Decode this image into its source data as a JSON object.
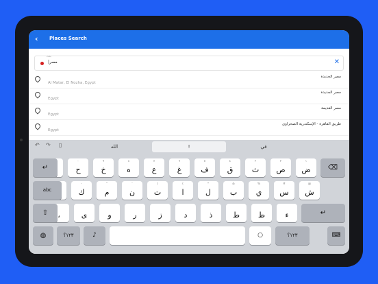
{
  "app": {
    "title": "Places Search",
    "back_icon": "‹"
  },
  "search": {
    "label": "بحث",
    "value": "مصر|",
    "clear_icon": "✕"
  },
  "results": [
    {
      "name": "مصر الجديدة",
      "sub": "Al Matar, El Nozha, Egypt"
    },
    {
      "name": "مصر الجديدة",
      "sub": "Egypt"
    },
    {
      "name": "مصر القديمة",
      "sub": "Egypt"
    },
    {
      "name": "طريق القاهرة - الإسكندرية الصحراوي",
      "sub": "Egypt"
    }
  ],
  "keyboard": {
    "toolbar": {
      "undo": "↶",
      "redo": "↷",
      "paste": "▯"
    },
    "suggestions": [
      "الله",
      "!",
      "في"
    ],
    "row1": [
      {
        "main": "ض",
        "hint": "١"
      },
      {
        "main": "ص",
        "hint": "٢"
      },
      {
        "main": "ث",
        "hint": "٣"
      },
      {
        "main": "ق",
        "hint": "٤"
      },
      {
        "main": "ف",
        "hint": "٥"
      },
      {
        "main": "غ",
        "hint": "٦"
      },
      {
        "main": "ع",
        "hint": "٧"
      },
      {
        "main": "ه",
        "hint": "٨"
      },
      {
        "main": "خ",
        "hint": "٩"
      },
      {
        "main": "ح",
        "hint": "٠"
      },
      {
        "main": "ج",
        "hint": "،"
      }
    ],
    "row2": [
      {
        "main": "ش",
        "hint": "@"
      },
      {
        "main": "س",
        "hint": "#"
      },
      {
        "main": "ي",
        "hint": "%"
      },
      {
        "main": "ب",
        "hint": "&"
      },
      {
        "main": "ل",
        "hint": "*"
      },
      {
        "main": "ا",
        "hint": "("
      },
      {
        "main": "ت",
        "hint": ")"
      },
      {
        "main": "ن",
        "hint": "'"
      },
      {
        "main": "م",
        "hint": "\""
      },
      {
        "main": "ك",
        "hint": "-"
      },
      {
        "main": "ة",
        "hint": ":"
      }
    ],
    "row3": [
      {
        "main": "ء",
        "hint": ""
      },
      {
        "main": "ظ",
        "hint": ""
      },
      {
        "main": "ط",
        "hint": ""
      },
      {
        "main": "ذ",
        "hint": ""
      },
      {
        "main": "د",
        "hint": ""
      },
      {
        "main": "ز",
        "hint": ""
      },
      {
        "main": "ر",
        "hint": ""
      },
      {
        "main": "و",
        "hint": ""
      },
      {
        "main": "ى",
        "hint": ""
      },
      {
        "main": "،",
        "hint": ""
      }
    ],
    "delete_icon": "⌫",
    "abc_label": "abc",
    "return_icon": "↵",
    "shift_icon": "⇧",
    "num_left": "١٢٣؟",
    "num_right": "١٢٣؟",
    "globe_icon": "◍",
    "mic_icon": "♪",
    "dismiss_icon": "⌨"
  }
}
